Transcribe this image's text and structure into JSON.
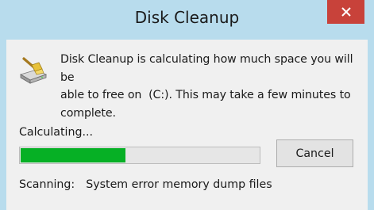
{
  "window": {
    "title": "Disk Cleanup",
    "close_icon": "close-icon",
    "colors": {
      "frame": "#b8dced",
      "client": "#f0f0f0",
      "close": "#c8423a",
      "progress_fill": "#06b025"
    }
  },
  "dialog": {
    "app_icon": "disk-cleanup-icon",
    "message_line1": "Disk Cleanup is calculating how much space you will be",
    "message_line2": "able to free on  (C:). This may take a few minutes to",
    "message_line3": "complete.",
    "calculating_label": "Calculating...",
    "progress": 0.44,
    "cancel_label": "Cancel",
    "scanning_label": "Scanning:",
    "scanning_value": "System error memory dump files"
  }
}
